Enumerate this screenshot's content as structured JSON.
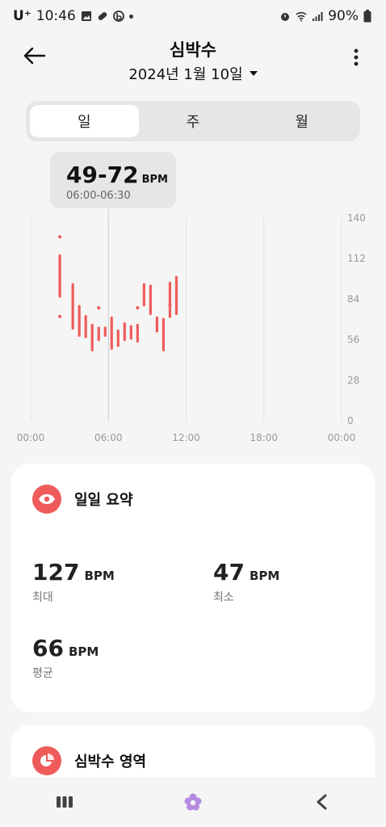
{
  "status_bar": {
    "carrier": "U⁺",
    "time": "10:46",
    "battery": "90%"
  },
  "header": {
    "title": "심박수",
    "date": "2024년 1월 10일"
  },
  "tabs": [
    {
      "label": "일",
      "active": true
    },
    {
      "label": "주",
      "active": false
    },
    {
      "label": "월",
      "active": false
    }
  ],
  "tooltip": {
    "range": "49-72",
    "unit": "BPM",
    "time": "06:00-06:30"
  },
  "chart_data": {
    "type": "bar",
    "x_ticks": [
      "00:00",
      "06:00",
      "12:00",
      "18:00",
      "00:00"
    ],
    "y_ticks": [
      "140",
      "112",
      "84",
      "56",
      "28",
      "0"
    ],
    "ylim": [
      0,
      140
    ],
    "x_range_hours": [
      0,
      24
    ],
    "selected_hour": 6,
    "color": "#ef5b5b",
    "ranges": [
      {
        "hour": 2.25,
        "min": 85,
        "max": 115
      },
      {
        "hour": 3.25,
        "min": 63,
        "max": 95
      },
      {
        "hour": 3.75,
        "min": 58,
        "max": 80
      },
      {
        "hour": 4.25,
        "min": 57,
        "max": 73
      },
      {
        "hour": 4.75,
        "min": 48,
        "max": 67
      },
      {
        "hour": 5.25,
        "min": 55,
        "max": 65
      },
      {
        "hour": 5.75,
        "min": 58,
        "max": 65
      },
      {
        "hour": 6.25,
        "min": 49,
        "max": 72
      },
      {
        "hour": 6.75,
        "min": 51,
        "max": 63
      },
      {
        "hour": 7.25,
        "min": 55,
        "max": 68
      },
      {
        "hour": 7.75,
        "min": 56,
        "max": 66
      },
      {
        "hour": 8.25,
        "min": 54,
        "max": 67
      },
      {
        "hour": 8.75,
        "min": 79,
        "max": 95
      },
      {
        "hour": 9.25,
        "min": 73,
        "max": 94
      },
      {
        "hour": 9.75,
        "min": 61,
        "max": 72
      },
      {
        "hour": 10.25,
        "min": 48,
        "max": 71
      },
      {
        "hour": 10.75,
        "min": 71,
        "max": 96
      },
      {
        "hour": 11.25,
        "min": 73,
        "max": 100
      }
    ],
    "points": [
      {
        "hour": 2.25,
        "value": 127
      },
      {
        "hour": 2.25,
        "value": 72
      },
      {
        "hour": 5.25,
        "value": 78
      },
      {
        "hour": 8.25,
        "value": 78
      },
      {
        "hour": 10.75,
        "value": 80
      }
    ]
  },
  "summary": {
    "title": "일일 요약",
    "max_value": "127",
    "max_label": "최대",
    "min_value": "47",
    "min_label": "최소",
    "avg_value": "66",
    "avg_label": "평균",
    "unit": "BPM"
  },
  "zones": {
    "title": "심박수 영역"
  },
  "icons": {
    "back": "arrow-left-icon",
    "more": "more-vert-icon",
    "summary": "eye-icon",
    "zones": "pie-chart-icon"
  },
  "colors": {
    "accent": "#ef5b5b",
    "background": "#f5f5f5"
  }
}
